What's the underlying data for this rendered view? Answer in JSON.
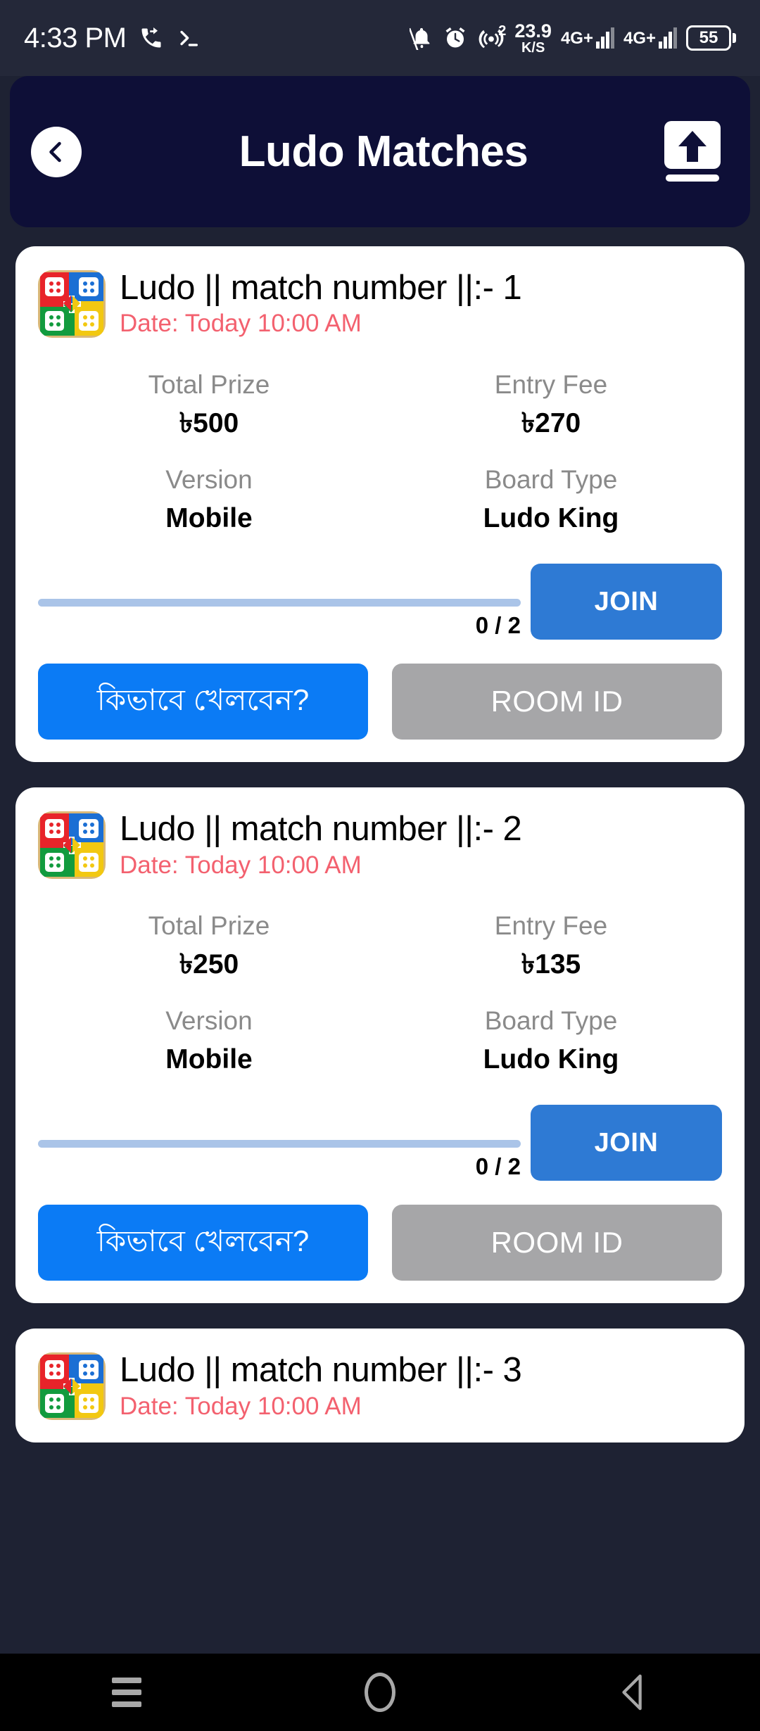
{
  "status_bar": {
    "time": "4:33 PM",
    "left_icons": [
      "call-forward-icon",
      "terminal-icon"
    ],
    "network_speed_value": "23.9",
    "network_speed_unit": "K/S",
    "hotspot_badge": "2",
    "sim1_network": "4G+",
    "sim2_network": "4G+",
    "battery_percent": "55",
    "right_icons": [
      "bell-off-icon",
      "alarm-icon",
      "hotspot-icon"
    ]
  },
  "header": {
    "title": "Ludo Matches",
    "back_icon": "chevron-left-icon",
    "upload_icon": "upload-icon"
  },
  "labels": {
    "total_prize": "Total Prize",
    "entry_fee": "Entry Fee",
    "version": "Version",
    "board_type": "Board Type",
    "join": "JOIN",
    "how_to_play": "কিভাবে খেলবেন?",
    "room_id": "ROOM ID"
  },
  "colors": {
    "background": "#1e2233",
    "appbar": "#0e0f37",
    "card": "#ffffff",
    "join_blue": "#2e7ad4",
    "how_blue": "#0b7bf5",
    "room_grey": "#a6a6a8",
    "date_red": "#f3616f",
    "progress_track": "#aac4e8"
  },
  "matches": [
    {
      "title": "Ludo || match number ||:- 1",
      "date": "Date: Today 10:00 AM",
      "total_prize": "৳500",
      "entry_fee": "৳270",
      "version": "Mobile",
      "board_type": "Ludo King",
      "slots": "0 / 2",
      "progress_percent": 0
    },
    {
      "title": "Ludo || match number ||:- 2",
      "date": "Date: Today 10:00 AM",
      "total_prize": "৳250",
      "entry_fee": "৳135",
      "version": "Mobile",
      "board_type": "Ludo King",
      "slots": "0 / 2",
      "progress_percent": 0
    },
    {
      "title": "Ludo || match number ||:- 3",
      "date": "Date: Today 10:00 AM",
      "total_prize": "",
      "entry_fee": "",
      "version": "",
      "board_type": "",
      "slots": "",
      "progress_percent": 0
    }
  ],
  "nav_bar": {
    "recents_icon": "menu-icon",
    "home_icon": "circle-icon",
    "back_icon": "triangle-back-icon"
  }
}
